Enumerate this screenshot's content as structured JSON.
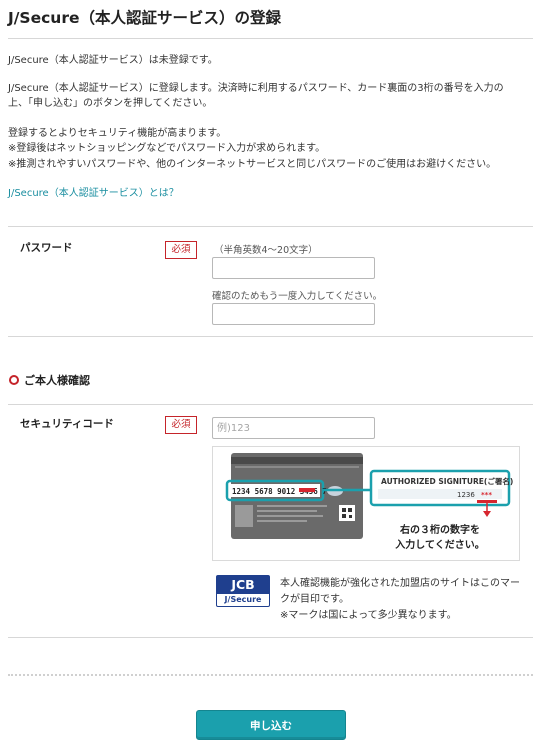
{
  "page": {
    "title": "J/Secure（本人認証サービス）の登録"
  },
  "intro": {
    "status": "J/Secure（本人認証サービス）は未登録です。",
    "instruction_line1": "J/Secure（本人認証サービス）に登録します。決済時に利用するパスワード、カード裏面の3桁の番号を入力の",
    "instruction_line2": "上、「申し込む」のボタンを押してください。",
    "security_line": "登録するとよりセキュリティ機能が高まります。",
    "note1": "※登録後はネットショッピングなどでパスワード入力が求められます。",
    "note2": "※推測されやすいパスワードや、他のインターネットサービスと同じパスワードのご使用はお避けください。",
    "link": "J/Secure（本人認証サービス）とは？"
  },
  "password": {
    "label": "パスワード",
    "required": "必須",
    "hint": "（半角英数4～20文字）",
    "value": "",
    "confirm_hint": "確認のためもう一度入力してください。",
    "confirm_value": ""
  },
  "identity": {
    "section_title": "ご本人様確認",
    "security_code_label": "セキュリティコード",
    "required": "必須",
    "placeholder": "例)123"
  },
  "card_illustration": {
    "number": "1234 5678 9012 3456 789",
    "authorized_title": "AUTHORIZED SIGNITURE(ご署名)",
    "digits": "1236",
    "caption_line1": "右の３桁の数字を",
    "caption_line2": "入力してください。",
    "teal_color": "#1ba0ad",
    "red_color": "#d7262f"
  },
  "jcb": {
    "logo_top": "JCB",
    "logo_bottom": "J/Secure",
    "text_line1": "本人確認機能が強化された加盟店のサイトはこのマー",
    "text_line2": "クが目印です。",
    "text_line3": "※マークは国によって多少異なります。"
  },
  "submit": {
    "label": "申し込む"
  },
  "colors": {
    "accent": "#1ba0ad",
    "required": "#c5242a",
    "link": "#1a8ea0"
  }
}
